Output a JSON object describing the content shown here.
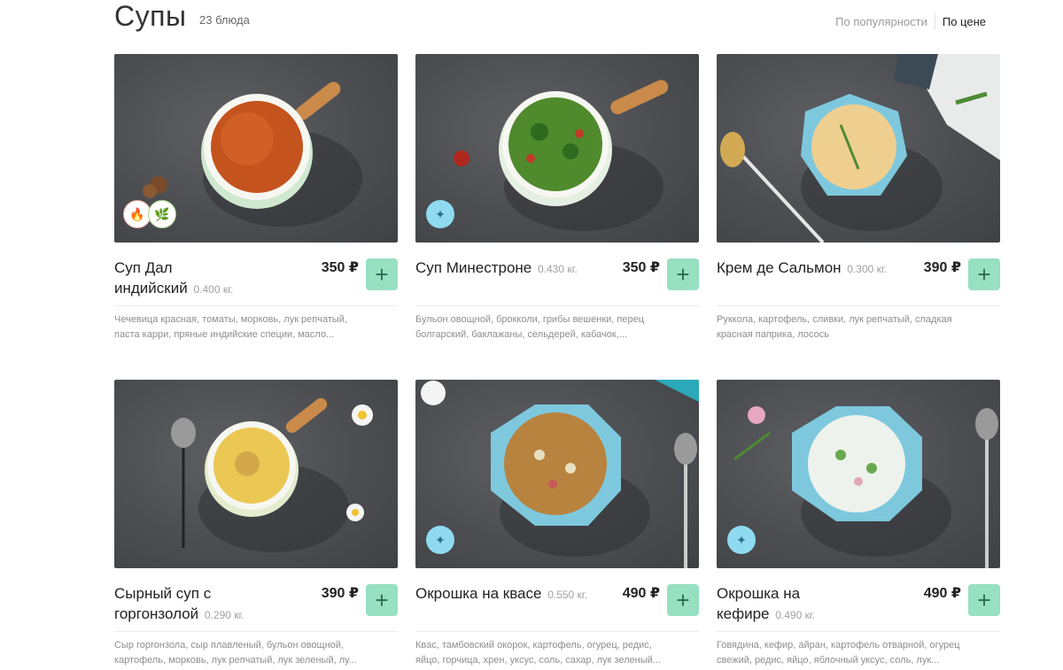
{
  "header": {
    "title": "Супы",
    "count": "23 блюда",
    "sort": {
      "popularity": "По популярности",
      "price": "По цене"
    }
  },
  "colors": {
    "accent_button": "#97e0c2",
    "badge_new": "#8fdaf0",
    "photo_bg": "#4f5155"
  },
  "dishes": [
    {
      "name_line1": "Суп Дал",
      "name_line2": "индийский",
      "weight": "0.400 кг.",
      "price": "350 ₽",
      "description_line1": "Чечевица красная, томаты, морковь, лук репчатый,",
      "description_line2": "паста карри, пряные индийские специи, масло...",
      "badges": [
        "fire-icon",
        "leaf-icon"
      ]
    },
    {
      "name_line1": "Суп Минестроне",
      "name_line2": "",
      "weight": "0.430 кг.",
      "price": "350 ₽",
      "description_line1": "Бульон овощной, брокколи, грибы вешенки, перец",
      "description_line2": "болгарский, баклажаны, сельдерей, кабачок,...",
      "badges": [
        "sparkle-icon"
      ]
    },
    {
      "name_line1": "Крем де Сальмон",
      "name_line2": "",
      "weight": "0.300 кг.",
      "price": "390 ₽",
      "description_line1": "Руккола, картофель, сливки, лук репчатый, сладкая",
      "description_line2": "красная паприка, лосось",
      "badges": []
    },
    {
      "name_line1": "Сырный суп с",
      "name_line2": "горгонзолой",
      "weight": "0.290 кг.",
      "price": "390 ₽",
      "description_line1": "Сыр горгонзола, сыр плавленый, бульон овощной,",
      "description_line2": "картофель, морковь, лук репчатый, лук зеленый, лу...",
      "badges": []
    },
    {
      "name_line1": "Окрошка на квасе",
      "name_line2": "",
      "weight": "0.550 кг.",
      "price": "490 ₽",
      "description_line1": "Квас, тамбовский окорок, картофель, огурец, редис,",
      "description_line2": "яйцо, горчица, хрен, уксус, соль, сахар, лук зеленый...",
      "badges": [
        "sparkle-icon"
      ]
    },
    {
      "name_line1": "Окрошка на",
      "name_line2": "кефире",
      "weight": "0.490 кг.",
      "price": "490 ₽",
      "description_line1": "Говядина, кефир, айран, картофель отварной, огурец",
      "description_line2": "свежий, редис, яйцо, яблочный уксус, соль, лук...",
      "badges": [
        "sparkle-icon"
      ]
    }
  ]
}
